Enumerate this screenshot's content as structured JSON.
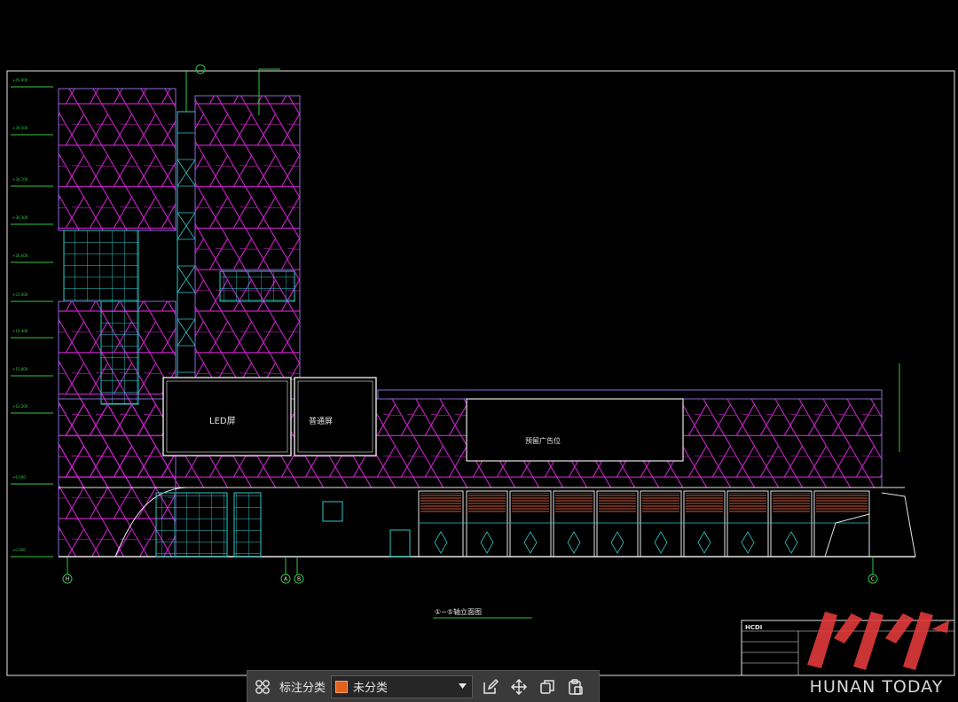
{
  "drawing": {
    "labels": {
      "led_screen": "LED屏",
      "billboard": "普通屏",
      "ad_slot": "预留广告位",
      "elevation_title": "①~⑤轴立面图",
      "title_block_logo": "HCDI"
    },
    "axis_markers": [
      "H",
      "A",
      "B",
      "C"
    ]
  },
  "toolbar": {
    "grid_icon": "grid-icon",
    "label": "标注分类",
    "category_select": {
      "value": "未分类",
      "swatch_color": "#e0621c"
    },
    "buttons": [
      "edit-icon",
      "move-icon",
      "copy-icon",
      "paste-icon"
    ]
  },
  "watermark": {
    "text": "HUNAN TODAY",
    "logo_text": "新湖南"
  },
  "colors": {
    "background": "#000000",
    "frame": "#e6e6e6",
    "honeycomb": "#c020c0",
    "glass": "#2ec8c8",
    "accent": "#e0621c",
    "watermark": "#e23a3a"
  }
}
